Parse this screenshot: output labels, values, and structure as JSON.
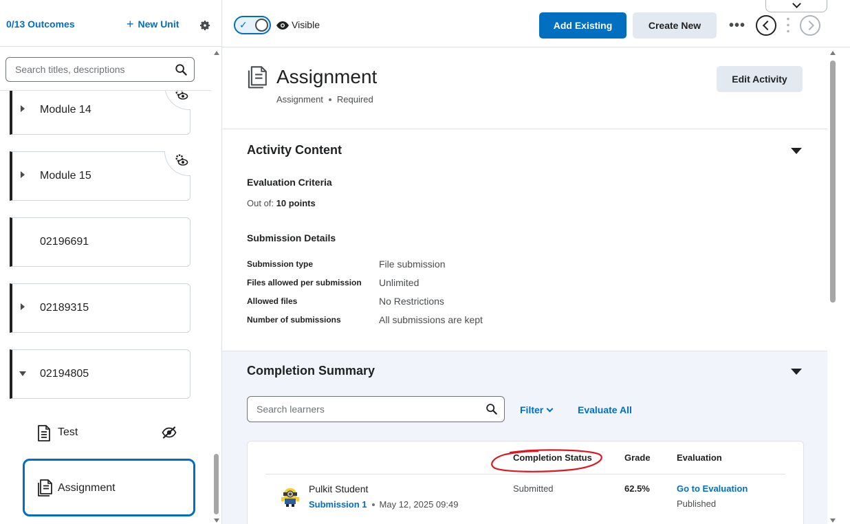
{
  "sidebar": {
    "outcomes_link": "0/13 Outcomes",
    "new_unit_label": "New Unit",
    "search_placeholder": "Search titles, descriptions",
    "units": [
      {
        "label": "Module 14",
        "expanded": false,
        "icon": "settings-eye-icon"
      },
      {
        "label": "Module 15",
        "expanded": false,
        "icon": "settings-eye-icon"
      },
      {
        "label": "02196691",
        "expanded": null
      },
      {
        "label": "02189315",
        "expanded": false
      },
      {
        "label": "02194805",
        "expanded": true
      }
    ],
    "topics": [
      {
        "label": "Test",
        "hidden": true
      },
      {
        "label": "Assignment",
        "selected": true
      }
    ]
  },
  "topbar": {
    "visibility_label": "Visible",
    "add_existing": "Add Existing",
    "create_new": "Create New",
    "more": "•••"
  },
  "activity": {
    "title": "Assignment",
    "type": "Assignment",
    "requirement": "Required",
    "edit_button": "Edit Activity",
    "content_section_title": "Activity Content",
    "evaluation_criteria_title": "Evaluation Criteria",
    "out_of_label": "Out of:",
    "out_of_value": "10 points",
    "submission_details_title": "Submission Details",
    "details": [
      {
        "key": "Submission type",
        "value": "File submission"
      },
      {
        "key": "Files allowed per submission",
        "value": "Unlimited"
      },
      {
        "key": "Allowed files",
        "value": "No Restrictions"
      },
      {
        "key": "Number of submissions",
        "value": "All submissions are kept"
      }
    ]
  },
  "completion": {
    "title": "Completion Summary",
    "search_placeholder": "Search learners",
    "filter_label": "Filter",
    "evaluate_all": "Evaluate All",
    "columns": {
      "status": "Completion Status",
      "grade": "Grade",
      "evaluation": "Evaluation"
    },
    "rows": [
      {
        "name": "Pulkit Student",
        "submission": "Submission 1",
        "date": "May 12, 2025 09:49",
        "status": "Submitted",
        "grade": "62.5%",
        "evaluation_link": "Go to Evaluation",
        "evaluation_state": "Published"
      }
    ]
  },
  "colors": {
    "brand_blue": "#006fbf",
    "annotation_red": "#e0141e"
  }
}
